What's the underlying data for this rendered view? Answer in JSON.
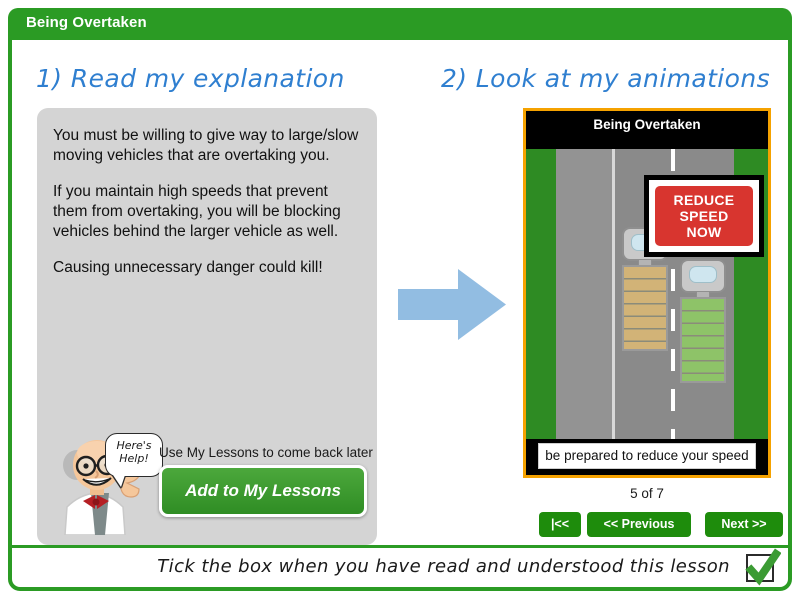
{
  "window": {
    "title": "Being Overtaken"
  },
  "headings": {
    "left": "1) Read my explanation",
    "right": "2) Look at my animations"
  },
  "explanation": {
    "paragraphs": [
      "You must be willing to give way to large/slow moving vehicles that are overtaking you.",
      "If you maintain high speeds that prevent them from overtaking, you will be blocking vehicles behind the larger vehicle as well.",
      "Causing unnecessary danger could kill!"
    ]
  },
  "help": {
    "bubble_text": "Here's\nHelp!",
    "caption": "Use My Lessons to come back later",
    "add_button_label": "Add to My Lessons",
    "professor_icon": "professor-character-icon",
    "arrow_icon": "right-arrow-icon"
  },
  "animation": {
    "title": "Being Overtaken",
    "sign": {
      "line1": "REDUCE",
      "line2": "SPEED",
      "line3": "NOW"
    },
    "caption": "be prepared to reduce your speed",
    "page_counter": "5 of  7",
    "current_page": 5,
    "total_pages": 7
  },
  "nav": {
    "first_label": "|<<",
    "previous_label": "<< Previous",
    "next_label": "Next >>"
  },
  "confirm": {
    "text": "Tick the box when you have read and understood this lesson",
    "checked": true,
    "checkbox_icon": "checkmark-icon"
  },
  "colors": {
    "brand_green": "#2b9b24",
    "button_green": "#1e8c0c",
    "panel_grey": "#d4d4d4",
    "heading_blue": "#2f7fd0",
    "sign_red": "#d8352f",
    "animation_border_orange": "#f5a200",
    "arrow_blue": "#92bde2",
    "verge_green": "#2e8b23"
  }
}
